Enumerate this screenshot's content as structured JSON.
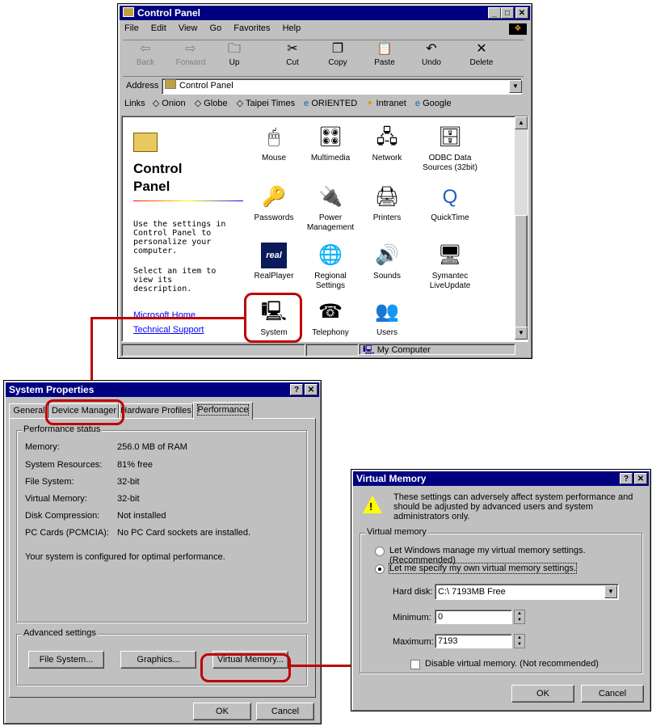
{
  "control_panel": {
    "title": "Control Panel",
    "menu": [
      "File",
      "Edit",
      "View",
      "Go",
      "Favorites",
      "Help"
    ],
    "toolbar": [
      "Back",
      "Forward",
      "Up",
      "Cut",
      "Copy",
      "Paste",
      "Undo",
      "Delete"
    ],
    "address_label": "Address",
    "address_value": "Control Panel",
    "links_label": "Links",
    "links": [
      "Onion",
      "Globe",
      "Taipei Times",
      "ORIENTED",
      "Intranet",
      "Google"
    ],
    "heading": "Control Panel",
    "description": "Use the settings in Control Panel to personalize your computer.",
    "hint": "Select an item to view its description.",
    "side_links": [
      "Microsoft Home",
      "Technical Support"
    ],
    "items": [
      "Mouse",
      "Multimedia",
      "Network",
      "ODBC Data Sources (32bit)",
      "Passwords",
      "Power Management",
      "Printers",
      "QuickTime",
      "RealPlayer",
      "Regional Settings",
      "Sounds",
      "Symantec LiveUpdate",
      "System",
      "Telephony",
      "Users"
    ],
    "status": "My Computer"
  },
  "system_properties": {
    "title": "System Properties",
    "tabs": [
      "General",
      "Device Manager",
      "Hardware Profiles",
      "Performance"
    ],
    "status_group": "Performance status",
    "rows": [
      {
        "label": "Memory:",
        "value": "256.0 MB of RAM"
      },
      {
        "label": "System Resources:",
        "value": "81% free"
      },
      {
        "label": "File System:",
        "value": "32-bit"
      },
      {
        "label": "Virtual Memory:",
        "value": "32-bit"
      },
      {
        "label": "Disk Compression:",
        "value": "Not installed"
      },
      {
        "label": "PC Cards (PCMCIA):",
        "value": "No PC Card sockets are installed."
      }
    ],
    "message": "Your system is configured for optimal performance.",
    "advanced_group": "Advanced settings",
    "buttons": [
      "File System...",
      "Graphics...",
      "Virtual Memory..."
    ],
    "ok": "OK",
    "cancel": "Cancel"
  },
  "virtual_memory": {
    "title": "Virtual Memory",
    "warning": "These settings can adversely affect system performance and should be adjusted by advanced users and system administrators only.",
    "group": "Virtual memory",
    "option_auto": "Let Windows manage my virtual memory settings. (Recommended)",
    "option_manual": "Let me specify my own virtual memory settings.",
    "selected_option": "manual",
    "hard_disk_label": "Hard disk:",
    "hard_disk_value": "C:\\ 7193MB Free",
    "minimum_label": "Minimum:",
    "minimum_value": "0",
    "maximum_label": "Maximum:",
    "maximum_value": "7193",
    "disable_label": "Disable virtual memory. (Not recommended)",
    "disable_checked": false,
    "ok": "OK",
    "cancel": "Cancel"
  },
  "colors": {
    "titlebar": "#000080",
    "face": "#c0c0c0",
    "highlight": "#c00000",
    "link": "#0000ff"
  }
}
